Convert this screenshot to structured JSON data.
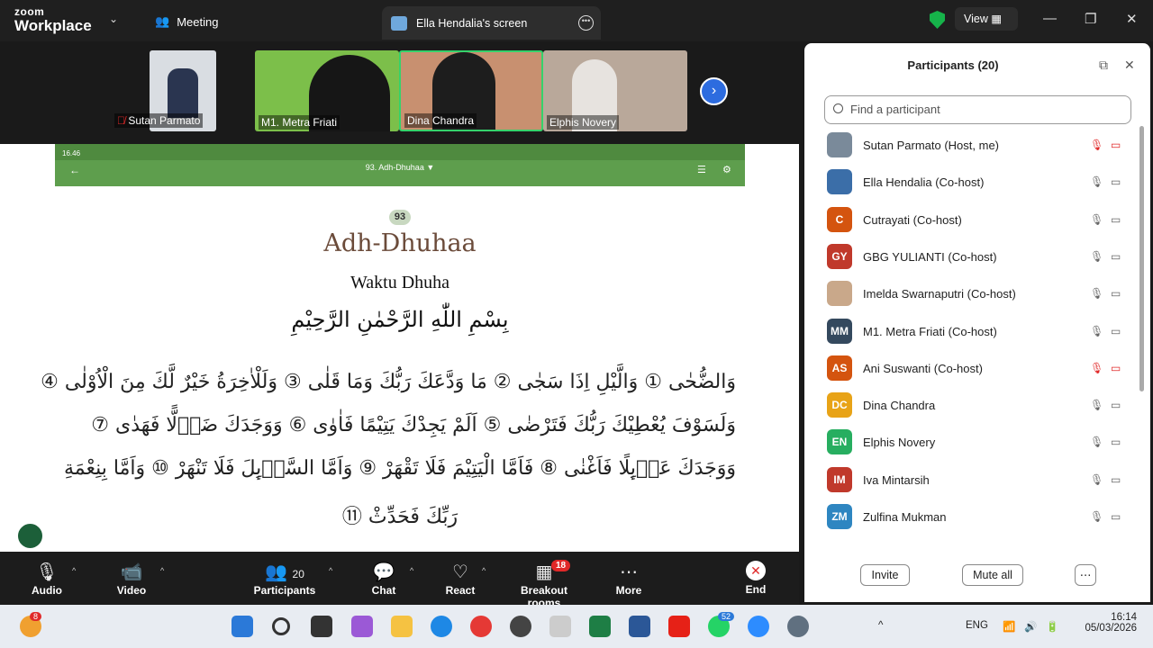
{
  "app": {
    "brand_top": "zoom",
    "brand_bottom": "Workplace"
  },
  "topbar": {
    "meeting_label": "Meeting",
    "share_tab": "Ella Hendalia's screen",
    "view_label": "View"
  },
  "videos": [
    {
      "name": "Sutan Parmato",
      "muted": true
    },
    {
      "name": "M1. Metra Friati"
    },
    {
      "name": "Dina Chandra"
    },
    {
      "name": "Elphis Novery"
    }
  ],
  "shared": {
    "status_time": "16.46",
    "surah_header": "93. Adh-Dhuhaa ▼",
    "number": "93",
    "title": "Adh-Dhuhaa",
    "subtitle": "Waktu Dhuha",
    "bismillah": "بِسْمِ اللّٰهِ الرَّحْمٰنِ الرَّحِيْمِ",
    "lines": [
      "وَالضُّحٰى ① وَالَّيْلِ اِذَا سَجٰى ② مَا وَدَّعَكَ رَبُّكَ وَمَا قَلٰى ③ وَلَلْاٰخِرَةُ خَيْرٌ لَّكَ مِنَ الْاُوْلٰى ④",
      "وَلَسَوْفَ يُعْطِيْكَ رَبُّكَ فَتَرْضٰى ⑤ اَلَمْ يَجِدْكَ يَتِيْمًا فَاٰوٰى ⑥ وَوَجَدَكَ ضَاۤلًّا فَهَدٰى ⑦",
      "وَوَجَدَكَ عَاۤىِٕلًا فَاَغْنٰى ⑧ فَاَمَّا الْيَتِيْمَ فَلَا تَقْهَرْ ⑨ وَاَمَّا السَّاۤىِٕلَ فَلَا تَنْهَرْ ⑩ وَاَمَّا بِنِعْمَةِ",
      "رَبِّكَ فَحَدِّثْ ⑪"
    ]
  },
  "toolbar": {
    "audio": "Audio",
    "video": "Video",
    "participants": "Participants",
    "participants_count": "20",
    "chat": "Chat",
    "react": "React",
    "breakout": "Breakout rooms",
    "breakout_badge": "18",
    "more": "More",
    "end": "End"
  },
  "panel": {
    "title": "Participants (20)",
    "search_placeholder": "Find a participant",
    "invite": "Invite",
    "mute_all": "Mute all",
    "participants": [
      {
        "initials": "",
        "name": "Sutan Parmato (Host, me)",
        "color": "#7a8a9a",
        "muted": true
      },
      {
        "initials": "",
        "name": "Ella Hendalia (Co-host)",
        "color": "#3b6ea8",
        "muted": false
      },
      {
        "initials": "C",
        "name": "Cutrayati (Co-host)",
        "color": "#d4540f",
        "muted": false
      },
      {
        "initials": "GY",
        "name": "GBG YULIANTI (Co-host)",
        "color": "#c0392b",
        "muted": false
      },
      {
        "initials": "",
        "name": "Imelda Swarnaputri (Co-host)",
        "color": "#c9a88a",
        "muted": false
      },
      {
        "initials": "MM",
        "name": "M1. Metra Friati (Co-host)",
        "color": "#34495e",
        "muted": false
      },
      {
        "initials": "AS",
        "name": "Ani Suswanti (Co-host)",
        "color": "#d4540f",
        "muted": true
      },
      {
        "initials": "DC",
        "name": "Dina Chandra",
        "color": "#e8a317",
        "muted": false
      },
      {
        "initials": "EN",
        "name": "Elphis Novery",
        "color": "#27ae60",
        "muted": false
      },
      {
        "initials": "IM",
        "name": "Iva Mintarsih",
        "color": "#c0392b",
        "muted": false
      },
      {
        "initials": "ZM",
        "name": "Zulfina Mukman",
        "color": "#2e86c1",
        "muted": false
      }
    ]
  },
  "taskbar": {
    "weather_badge": "8",
    "whatsapp_badge": "52",
    "lang": "ENG",
    "time": "16:14",
    "date": "05/03/2026"
  }
}
